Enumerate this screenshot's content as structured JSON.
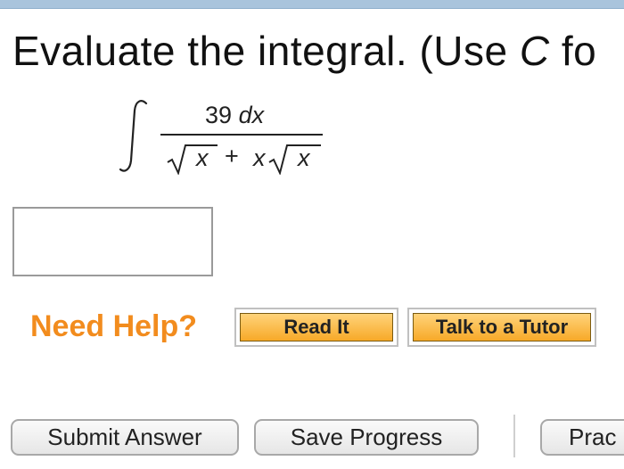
{
  "question": {
    "text_before": "Evaluate the integral. (Use ",
    "variable": "C",
    "text_after": " fo"
  },
  "formula": {
    "numerator": "39",
    "numerator_dx": "dx",
    "denominator_var1": "x",
    "denominator_plus": "+",
    "denominator_coeff": "x",
    "denominator_var2": "x"
  },
  "answer_input": {
    "value": "",
    "placeholder": ""
  },
  "help": {
    "title": "Need Help?",
    "read_it": "Read It",
    "talk_to_tutor": "Talk to a Tutor"
  },
  "actions": {
    "submit": "Submit Answer",
    "save": "Save Progress",
    "practice": "Prac"
  },
  "colors": {
    "help_title": "#f28c1e",
    "help_button": "#f7a928",
    "top_bar": "#a9c4dc"
  }
}
